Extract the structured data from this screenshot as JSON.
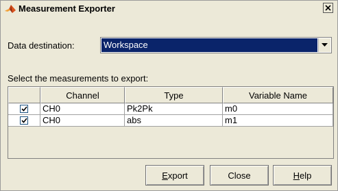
{
  "window": {
    "title": "Measurement Exporter"
  },
  "destination": {
    "label": "Data destination:",
    "value": "Workspace"
  },
  "select_label": "Select the measurements to export:",
  "table": {
    "columns": [
      "",
      "Channel",
      "Type",
      "Variable Name"
    ],
    "rows": [
      {
        "checked": true,
        "channel": "CH0",
        "type": "Pk2Pk",
        "variable": "m0"
      },
      {
        "checked": true,
        "channel": "CH0",
        "type": "abs",
        "variable": "m1"
      }
    ]
  },
  "buttons": {
    "export": {
      "mnemonic": "E",
      "rest": "xport"
    },
    "close": "Close",
    "help": {
      "mnemonic": "H",
      "rest": "elp"
    }
  },
  "colors": {
    "selection": "#0a246a",
    "face": "#ece9d8"
  }
}
